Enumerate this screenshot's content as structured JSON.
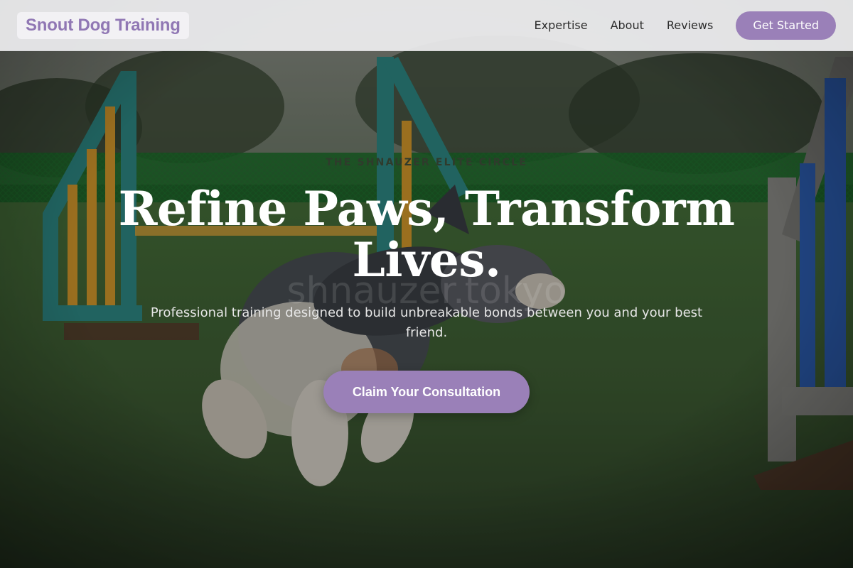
{
  "header": {
    "brand": "Snout Dog Training",
    "nav": [
      {
        "label": "Expertise"
      },
      {
        "label": "About"
      },
      {
        "label": "Reviews"
      }
    ],
    "cta_label": "Get Started"
  },
  "hero": {
    "eyebrow": "THE SHNAUZER ELITE CIRCLE",
    "headline": "Refine Paws, Transform Lives.",
    "watermark": "shnauzer.tokyo",
    "subtitle": "Professional training designed to build unbreakable bonds between you and your best friend.",
    "cta_label": "Claim Your Consultation",
    "background_image": "dog-agility-photo"
  },
  "colors": {
    "accent": "#9a80b8",
    "brand_text": "#9077b4",
    "header_bg": "#eeeef0",
    "headline": "#ffffff"
  }
}
